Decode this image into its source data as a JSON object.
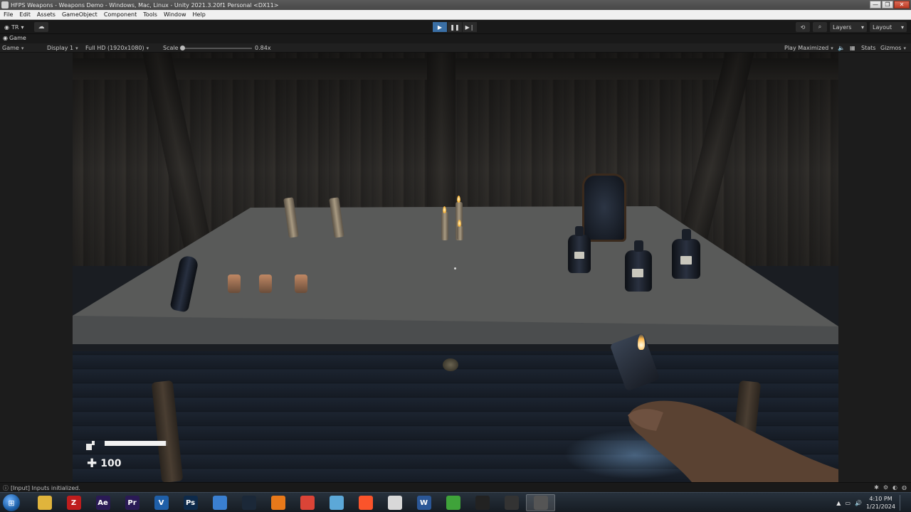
{
  "window": {
    "title": "HFPS Weapons - Weapons Demo - Windows, Mac, Linux - Unity 2021.3.20f1 Personal <DX11>",
    "controls": [
      "—",
      "❐",
      "✕"
    ]
  },
  "menubar": {
    "items": [
      "File",
      "Edit",
      "Assets",
      "GameObject",
      "Component",
      "Tools",
      "Window",
      "Help"
    ]
  },
  "toolbar": {
    "account": "TR",
    "layers_label": "Layers",
    "layout_label": "Layout"
  },
  "game_tab": {
    "label": "Game"
  },
  "game_bar": {
    "mode": "Game",
    "display": "Display 1",
    "resolution": "Full HD (1920x1080)",
    "scale_label": "Scale",
    "scale_value": "0.84x",
    "play_mode": "Play Maximized",
    "stats": "Stats",
    "gizmos": "Gizmos"
  },
  "hud": {
    "stamina_fraction": 0.98,
    "health": "100"
  },
  "status": {
    "message": "[Input] Inputs initialized."
  },
  "taskbar": {
    "apps": [
      {
        "name": "file-explorer",
        "glyph": "",
        "color": "#e0b43c"
      },
      {
        "name": "filezilla",
        "glyph": "Z",
        "color": "#bf1d1d"
      },
      {
        "name": "after-effects",
        "glyph": "Ae",
        "color": "#2a1a55"
      },
      {
        "name": "premiere-pro",
        "glyph": "Pr",
        "color": "#2a1a55"
      },
      {
        "name": "visual-studio",
        "glyph": "V",
        "color": "#1f5fa8"
      },
      {
        "name": "photoshop",
        "glyph": "Ps",
        "color": "#0e2a4a"
      },
      {
        "name": "application",
        "glyph": "",
        "color": "#3a7fd0"
      },
      {
        "name": "steam",
        "glyph": "",
        "color": "#1b2838"
      },
      {
        "name": "vlc",
        "glyph": "",
        "color": "#e8791a"
      },
      {
        "name": "chrome",
        "glyph": "",
        "color": "#db4437"
      },
      {
        "name": "notes",
        "glyph": "",
        "color": "#5ca8d8"
      },
      {
        "name": "brave",
        "glyph": "",
        "color": "#fb542b"
      },
      {
        "name": "application-2",
        "glyph": "",
        "color": "#d8d8d8"
      },
      {
        "name": "word",
        "glyph": "W",
        "color": "#2b5797"
      },
      {
        "name": "utorrent",
        "glyph": "",
        "color": "#3fa33a"
      },
      {
        "name": "unity-hub",
        "glyph": "",
        "color": "#222"
      },
      {
        "name": "unity",
        "glyph": "",
        "color": "#333"
      },
      {
        "name": "unity-editor",
        "glyph": "",
        "color": "#555"
      }
    ],
    "time": "4:10 PM",
    "date": "1/21/2024"
  }
}
